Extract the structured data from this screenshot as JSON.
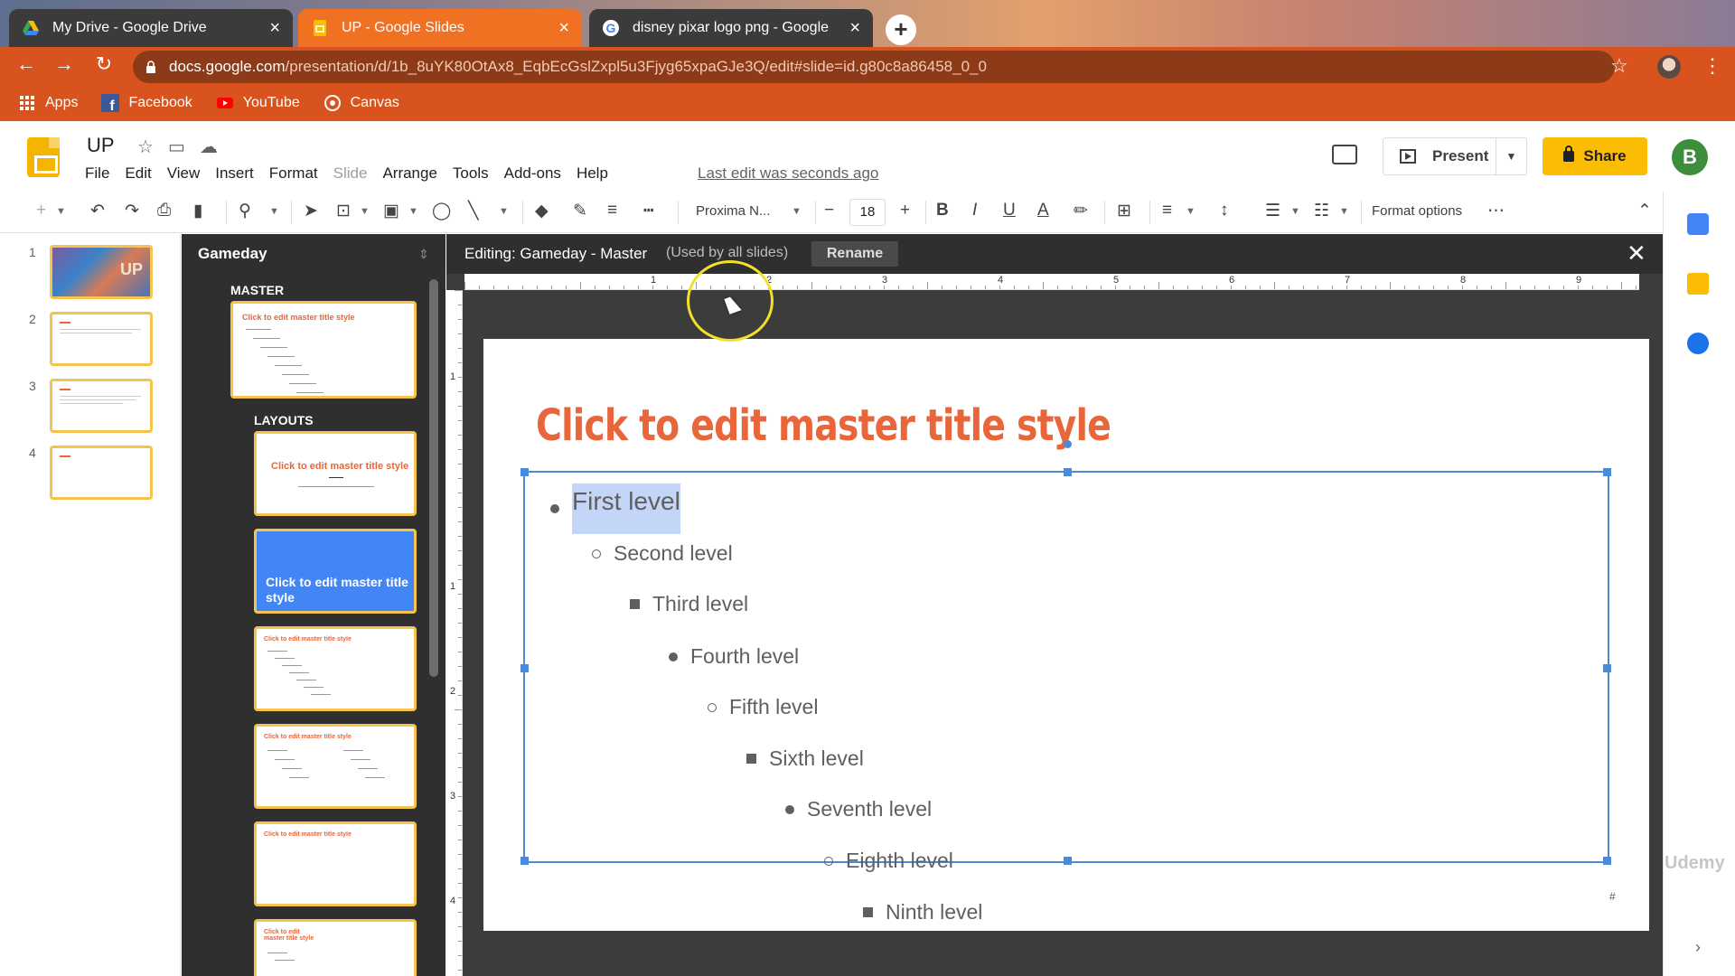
{
  "browser": {
    "tabs": [
      {
        "title": "My Drive - Google Drive",
        "icon": "google-drive-icon"
      },
      {
        "title": "UP - Google Slides",
        "icon": "google-slides-icon"
      },
      {
        "title": "disney pixar logo png - Google",
        "icon": "google-g-icon"
      }
    ],
    "url_host": "docs.google.com",
    "url_path": "/presentation/d/1b_8uYK80OtAx8_EqbEcGslZxpl5u3Fjyg65xpaGJe3Q/edit#slide=id.g80c8a86458_0_0",
    "bookmarks": [
      {
        "label": "Apps",
        "icon": "apps-grid-icon"
      },
      {
        "label": "Facebook",
        "icon": "facebook-icon"
      },
      {
        "label": "YouTube",
        "icon": "youtube-icon"
      },
      {
        "label": "Canvas",
        "icon": "canvas-icon"
      }
    ]
  },
  "app": {
    "doc_title": "UP",
    "menu": [
      "File",
      "Edit",
      "View",
      "Insert",
      "Format",
      "Slide",
      "Arrange",
      "Tools",
      "Add-ons",
      "Help"
    ],
    "last_edit": "Last edit was seconds ago",
    "present_label": "Present",
    "share_label": "Share",
    "avatar_letter": "B"
  },
  "toolbar": {
    "font_name": "Proxima N...",
    "font_size": "18",
    "format_options": "Format options"
  },
  "filmstrip": {
    "slides": [
      {
        "number": "1",
        "thumb_text": "UP"
      },
      {
        "number": "2"
      },
      {
        "number": "3"
      },
      {
        "number": "4"
      }
    ]
  },
  "master_panel": {
    "theme_name": "Gameday",
    "master_label": "MASTER",
    "layouts_label": "LAYOUTS",
    "layout_title": "Click to edit master title style"
  },
  "edit_bar": {
    "title": "Editing: Gameday - Master",
    "note": "(Used by all slides)",
    "rename": "Rename"
  },
  "ruler": {
    "h_numbers": [
      "1",
      "2",
      "3",
      "4",
      "5",
      "6",
      "7",
      "8",
      "9"
    ],
    "v_numbers": [
      "1",
      "1",
      "2",
      "3",
      "4"
    ]
  },
  "slide": {
    "title": "Click to edit master title style",
    "levels": [
      "First level",
      "Second level",
      "Third level",
      "Fourth level",
      "Fifth level",
      "Sixth level",
      "Seventh level",
      "Eighth level",
      "Ninth level"
    ],
    "page_marker": "#"
  },
  "watermark": "Udemy",
  "colors": {
    "title_orange": "#e8663a",
    "selection_blue": "#4a8ad6",
    "share_yellow": "#fbbc04",
    "active_tab": "#f07122"
  }
}
